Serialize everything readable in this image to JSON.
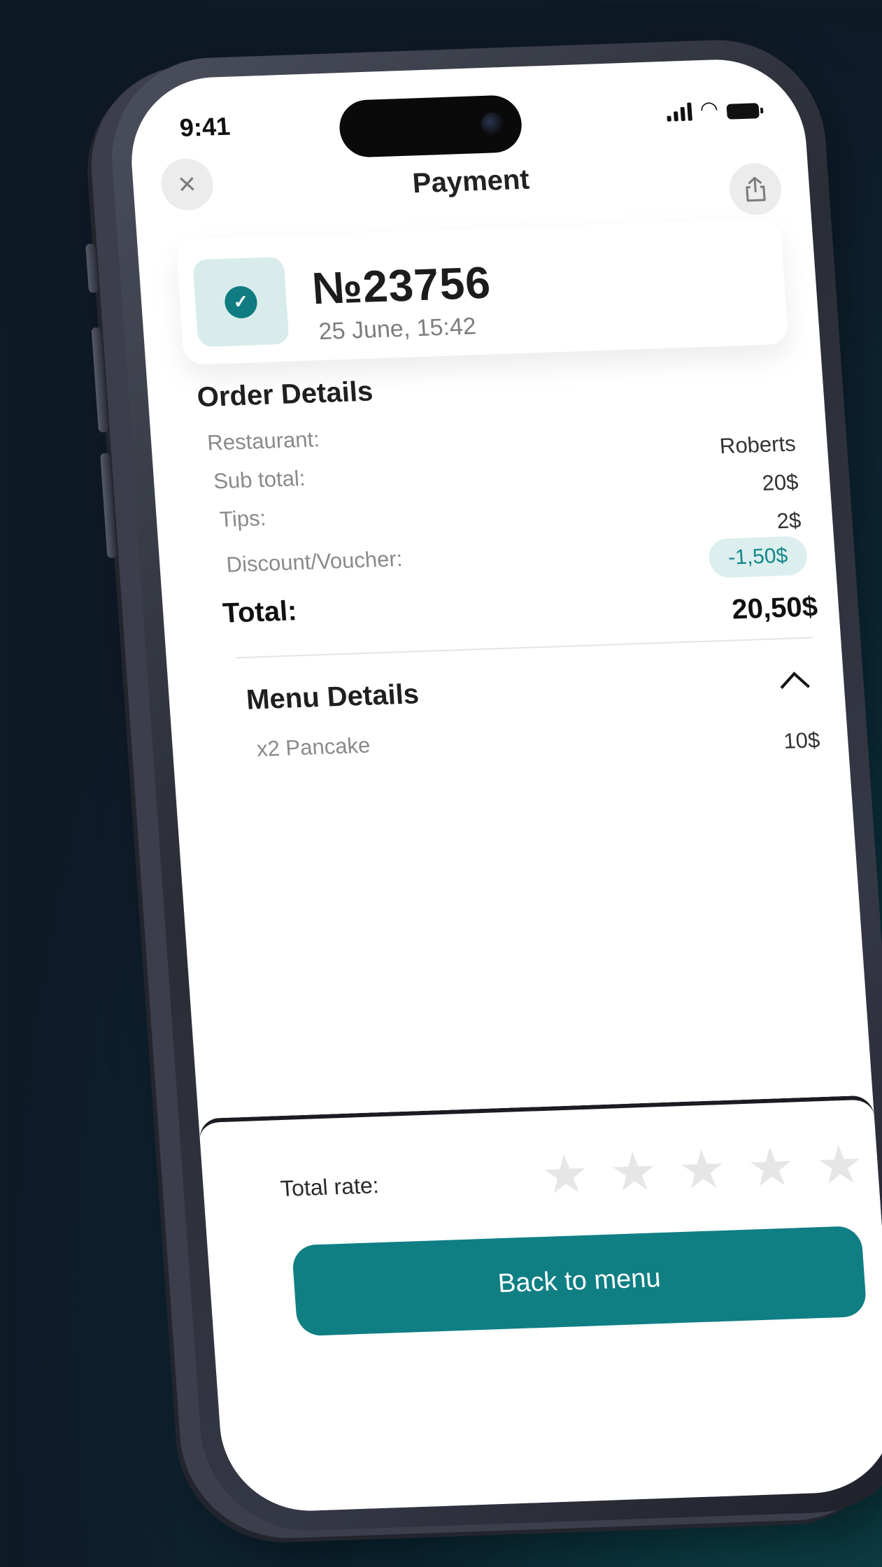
{
  "status_bar": {
    "time": "9:41"
  },
  "header": {
    "title": "Payment",
    "close_icon": "close-icon",
    "share_icon": "share-icon"
  },
  "order": {
    "number": "№23756",
    "date": "25 June, 15:42",
    "status_icon": "check-icon"
  },
  "order_details": {
    "title": "Order Details",
    "rows": [
      {
        "label": "Restaurant:",
        "value": "Roberts"
      },
      {
        "label": "Sub total:",
        "value": "20$"
      },
      {
        "label": "Tips:",
        "value": "2$"
      },
      {
        "label": "Discount/Voucher:",
        "value": "-1,50$"
      }
    ],
    "total_label": "Total:",
    "total_value": "20,50$"
  },
  "menu_details": {
    "title": "Menu Details",
    "items": [
      {
        "name": "x2 Pancake",
        "price": "10$"
      }
    ]
  },
  "rating": {
    "label": "Total rate:",
    "max_stars": 5,
    "selected": 0
  },
  "actions": {
    "back_label": "Back to menu"
  },
  "colors": {
    "accent": "#0f7f84",
    "accent_light": "#dceeee",
    "background": "#0f1a27"
  }
}
